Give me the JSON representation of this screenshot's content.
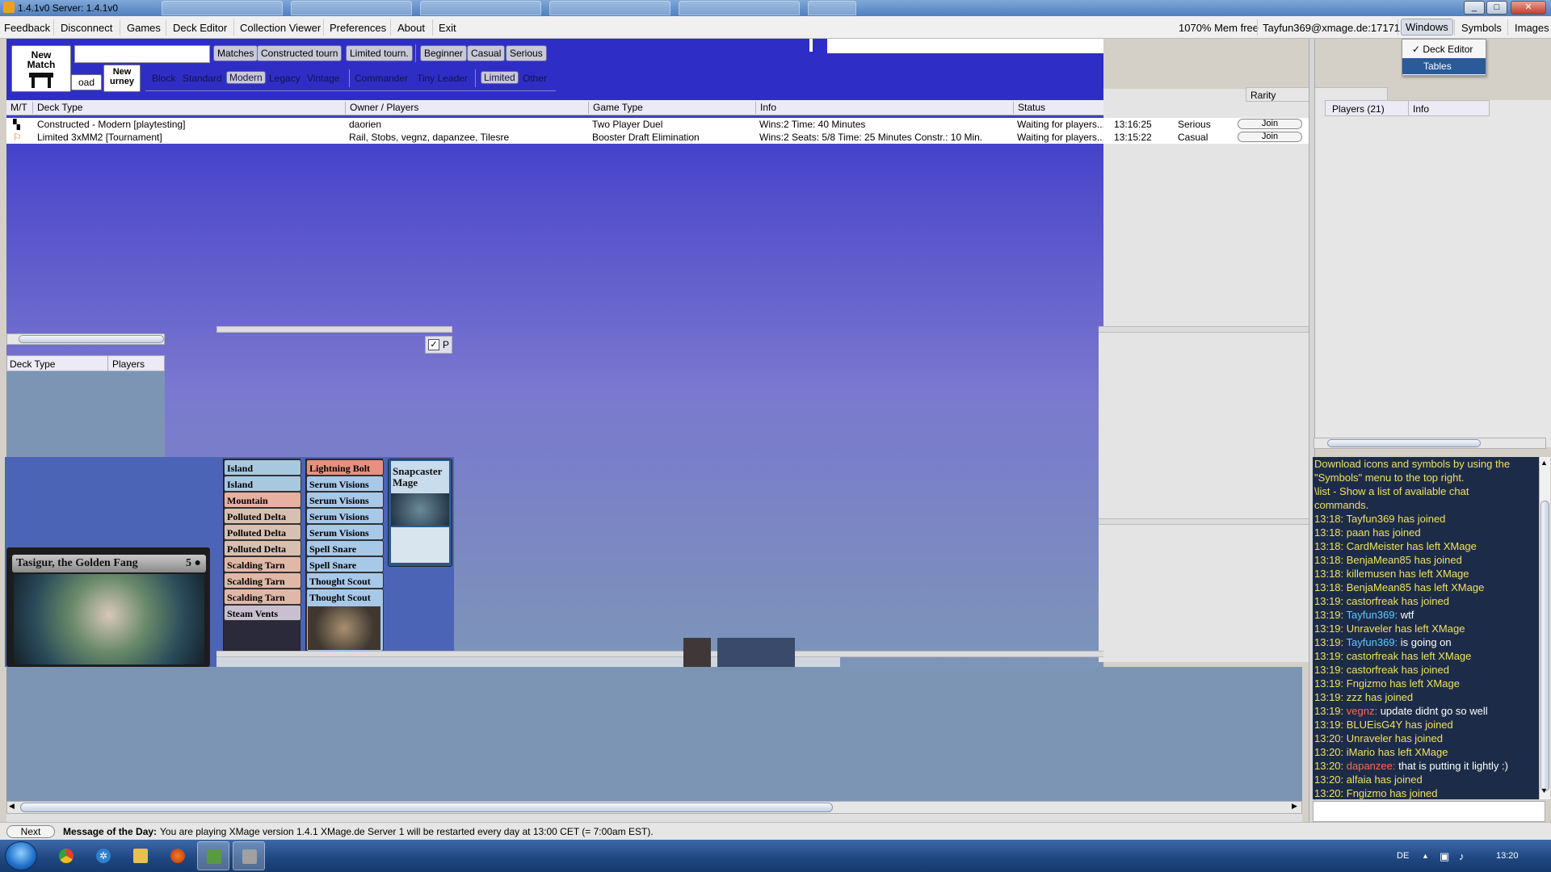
{
  "window": {
    "title": "1.4.1v0  Server: 1.4.1v0",
    "min": "_",
    "max": "□",
    "close": "✕"
  },
  "menu": {
    "left": [
      "Feedback",
      "Disconnect",
      "Games",
      "Deck Editor",
      "Collection Viewer",
      "Preferences",
      "About",
      "Exit"
    ],
    "mem": "1070% Mem free",
    "user": "Tayfun369@xmage.de:17171",
    "right": [
      "Windows",
      "Symbols",
      "Images"
    ]
  },
  "windows_dropdown": {
    "deck_editor": "✓ Deck Editor",
    "tables": "Tables"
  },
  "tables": {
    "new_match_line1": "New",
    "new_match_line2": "Match",
    "new_tourney": "New\nurney",
    "load": "oad",
    "type_buttons": [
      "Matches",
      "Constructed tourn",
      "Limited tourn."
    ],
    "skill_buttons": [
      "Beginner",
      "Casual",
      "Serious"
    ],
    "formats": [
      "Block",
      "Standard",
      "Modern",
      "Legacy",
      "Vintage"
    ],
    "formats2": [
      "Commander",
      "Tiny Leader"
    ],
    "formats3": [
      "Limited",
      "Other"
    ],
    "columns": [
      "M/T",
      "Deck Type",
      "Owner / Players",
      "Game Type",
      "Info",
      "Status"
    ],
    "rows": [
      {
        "deck_type": "Constructed - Modern [playtesting]",
        "owner": "daorien",
        "game_type": "Two Player Duel",
        "info": "Wins:2 Time: 40 Minutes",
        "status": "Waiting for players...",
        "time": "13:16:25",
        "skill": "Serious",
        "action": "Join"
      },
      {
        "deck_type": "Limited 3xMM2  [Tournament]",
        "owner": "Rail, Stobs, vegnz, dapanzee, Tilesre",
        "game_type": "Booster Draft Elimination",
        "info": "Wins:2 Seats: 5/8 Time: 25 Minutes Constr.: 10 Min.",
        "status": "Waiting for players...",
        "time": "13:15:22",
        "skill": "Casual",
        "action": "Join"
      }
    ],
    "checkbox_label": "P"
  },
  "right": {
    "rarity": "Rarity",
    "players": "Players (21)",
    "info": "Info"
  },
  "deck_list": {
    "columns": [
      "Deck Type",
      "Players"
    ]
  },
  "cards": {
    "featured": "Tasigur, the Golden Fang",
    "featured_cost": "5 ●",
    "col1": [
      "Island",
      "Island",
      "Mountain",
      "Polluted Delta",
      "Polluted Delta",
      "Polluted Delta",
      "Scalding Tarn",
      "Scalding Tarn",
      "Scalding Tarn",
      "Steam Vents"
    ],
    "col2": [
      "Lightning Bolt",
      "Serum Visions",
      "Serum Visions",
      "Serum Visions",
      "Serum Visions",
      "Spell Snare",
      "Spell Snare",
      "Thought Scout",
      "Thought Scout"
    ],
    "col3_title": "Snapcaster Mage"
  },
  "chat": {
    "intro": [
      "Download icons and symbols by using the",
      "\"Symbols\" menu to the top right.",
      "\\list - Show a list of available chat",
      "commands."
    ],
    "lines": [
      {
        "t": "13:18:",
        "u": "",
        "m": "Tayfun369 has joined",
        "k": "sys"
      },
      {
        "t": "13:18:",
        "u": "",
        "m": "paan has joined",
        "k": "sys"
      },
      {
        "t": "13:18:",
        "u": "",
        "m": "CardMeister has left XMage",
        "k": "sys"
      },
      {
        "t": "13:18:",
        "u": "",
        "m": "BenjaMean85 has joined",
        "k": "sys"
      },
      {
        "t": "13:18:",
        "u": "",
        "m": "killemusen has left XMage",
        "k": "sys"
      },
      {
        "t": "13:18:",
        "u": "",
        "m": "BenjaMean85 has left XMage",
        "k": "sys"
      },
      {
        "t": "13:19:",
        "u": "",
        "m": "castorfreak has joined",
        "k": "sys"
      },
      {
        "t": "13:19:",
        "u": "Tayfun369:",
        "m": "wtf",
        "k": "user"
      },
      {
        "t": "13:19:",
        "u": "",
        "m": "Unraveler has left XMage",
        "k": "sys"
      },
      {
        "t": "13:19:",
        "u": "Tayfun369:",
        "m": "is going on",
        "k": "user"
      },
      {
        "t": "13:19:",
        "u": "",
        "m": "castorfreak has left XMage",
        "k": "sys"
      },
      {
        "t": "13:19:",
        "u": "",
        "m": "castorfreak has joined",
        "k": "sys"
      },
      {
        "t": "13:19:",
        "u": "",
        "m": "Fngizmo has left XMage",
        "k": "sys"
      },
      {
        "t": "13:19:",
        "u": "",
        "m": "zzz has joined",
        "k": "sys"
      },
      {
        "t": "13:19:",
        "u": "vegnz:",
        "m": "update didnt go so well",
        "k": "red"
      },
      {
        "t": "13:19:",
        "u": "",
        "m": "BLUEisG4Y has joined",
        "k": "sys"
      },
      {
        "t": "13:20:",
        "u": "",
        "m": "Unraveler has joined",
        "k": "sys"
      },
      {
        "t": "13:20:",
        "u": "",
        "m": "iMario has left XMage",
        "k": "sys"
      },
      {
        "t": "13:20:",
        "u": "dapanzee:",
        "m": "that is putting it lightly :)",
        "k": "red"
      },
      {
        "t": "13:20:",
        "u": "",
        "m": "alfaia has joined",
        "k": "sys"
      },
      {
        "t": "13:20:",
        "u": "",
        "m": "Fngizmo has joined",
        "k": "sys"
      }
    ]
  },
  "status": {
    "next": "Next",
    "motd_label": "Message of the Day:",
    "motd": "You are playing XMage version 1.4.1 XMage.de Server 1 will be restarted every day at 13:00 CET (= 7:00am EST)."
  },
  "taskbar": {
    "lang": "DE",
    "clock": "13:20"
  },
  "colors": {
    "tables_bg": "#2e2ec6",
    "chat_bg": "#1c2c48",
    "chat_sys": "#f0e060",
    "chat_user": "#60c8ff",
    "chat_user_red": "#ff6a4a"
  }
}
